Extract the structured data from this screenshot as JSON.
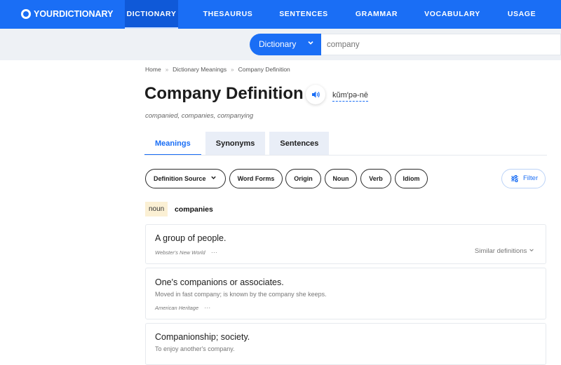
{
  "brand": {
    "logo_text": "YOURDICTIONARY"
  },
  "nav": [
    {
      "label": "DICTIONARY",
      "active": true
    },
    {
      "label": "THESAURUS",
      "active": false
    },
    {
      "label": "SENTENCES",
      "active": false
    },
    {
      "label": "GRAMMAR",
      "active": false
    },
    {
      "label": "VOCABULARY",
      "active": false
    },
    {
      "label": "USAGE",
      "active": false
    }
  ],
  "search": {
    "dropdown_label": "Dictionary",
    "placeholder": "company"
  },
  "breadcrumb": [
    "Home",
    "Dictionary Meanings",
    "Company Definition"
  ],
  "word": {
    "title": "Company Definition",
    "pronunciation": "kŭm′pə-nē",
    "forms": "companied, companies, companying"
  },
  "tabs": [
    {
      "label": "Meanings",
      "active": true
    },
    {
      "label": "Synonyms",
      "active": false
    },
    {
      "label": "Sentences",
      "active": false
    }
  ],
  "chips": {
    "source": "Definition Source",
    "items": [
      "Word Forms",
      "Origin",
      "Noun",
      "Verb",
      "Idiom"
    ],
    "filter": "Filter"
  },
  "pos": {
    "tag": "noun",
    "word": "companies"
  },
  "definitions": [
    {
      "text": "A group of people.",
      "source": "Webster's New World",
      "more": "···",
      "similar": "Similar definitions"
    },
    {
      "text": "One's companions or associates.",
      "example": "Moved in fast company; is known by the company she keeps.",
      "source": "American Heritage",
      "more": "···"
    },
    {
      "text": "Companionship; society.",
      "example": "To enjoy another's company."
    }
  ],
  "colors": {
    "primary": "#1a6ef5",
    "nav_active": "#0f59d8",
    "pos_bg": "#fbf0d4"
  }
}
